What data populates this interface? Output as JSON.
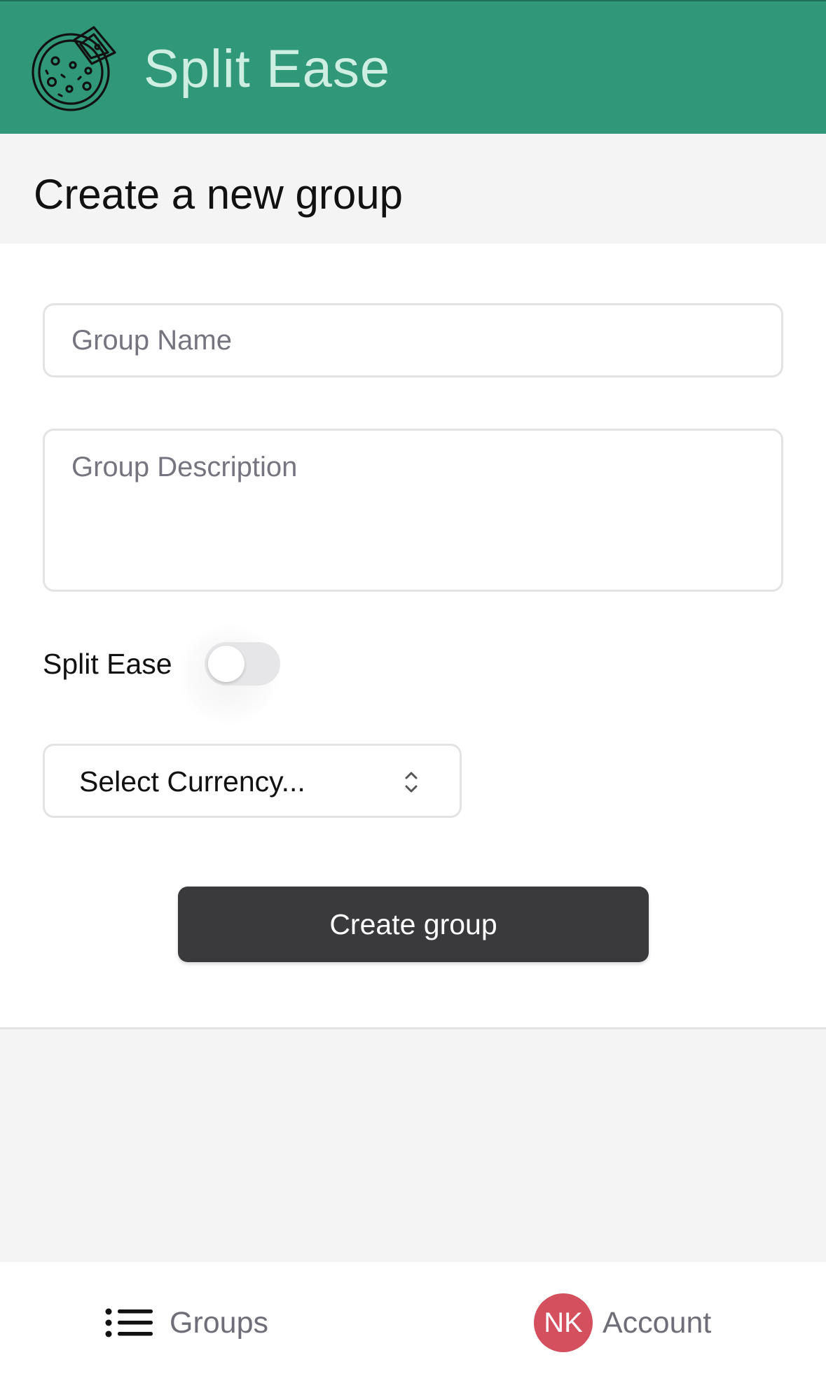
{
  "header": {
    "app_title": "Split Ease",
    "logo_icon": "pizza-icon",
    "background_color": "#309878",
    "title_color": "#cdeee0"
  },
  "page": {
    "title": "Create a new group"
  },
  "form": {
    "group_name": {
      "value": "",
      "placeholder": "Group Name"
    },
    "group_description": {
      "value": "",
      "placeholder": "Group Description"
    },
    "toggle": {
      "label": "Split Ease",
      "state": "off"
    },
    "currency": {
      "selected": "Select Currency...",
      "icon": "chevrons-up-down-icon"
    },
    "submit_label": "Create group"
  },
  "bottom_nav": {
    "groups": {
      "label": "Groups",
      "icon": "list-icon"
    },
    "account": {
      "label": "Account",
      "avatar_initials": "NK",
      "avatar_color": "#d4505e"
    }
  }
}
